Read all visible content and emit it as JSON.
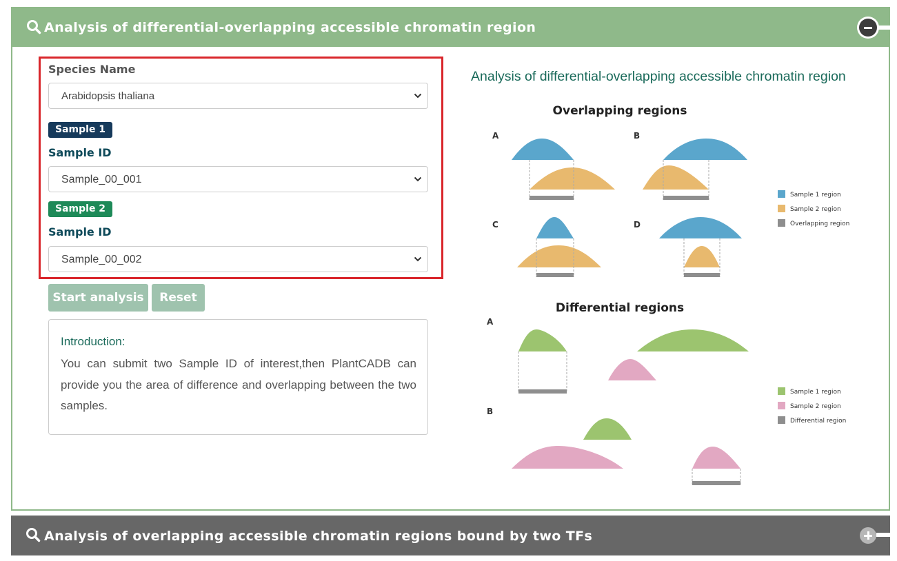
{
  "panel1": {
    "title": "Analysis of differential-overlapping accessible chromatin region"
  },
  "form": {
    "species_label": "Species Name",
    "species_value": "Arabidopsis thaliana",
    "sample1_badge": "Sample 1",
    "sample1_id_label": "Sample ID",
    "sample1_value": "Sample_00_001",
    "sample2_badge": "Sample 2",
    "sample2_id_label": "Sample ID",
    "sample2_value": "Sample_00_002",
    "start_label": "Start analysis",
    "reset_label": "Reset"
  },
  "intro": {
    "title": "Introduction:",
    "text": "You can submit two Sample ID of interest,then PlantCADB can provide you the area of difference and overlapping between the two samples."
  },
  "diagram": {
    "title": "Analysis of differential-overlapping accessible chromatin region",
    "overlap_heading": "Overlapping regions",
    "diff_heading": "Differential regions",
    "letters": {
      "a": "A",
      "b": "B",
      "c": "C",
      "d": "D"
    },
    "legend1": {
      "s1": "Sample 1 region",
      "s2": "Sample 2 region",
      "overlap": "Overlapping region"
    },
    "legend2": {
      "s1": "Sample 1 region",
      "s2": "Sample 2 region",
      "diff": "Differential region"
    },
    "colors": {
      "blue": "#5aa6cc",
      "orange": "#e8b96e",
      "green": "#9cc46f",
      "pink": "#e2a8c2",
      "gray": "#8e8e8e"
    }
  },
  "panel2": {
    "title": "Analysis of overlapping accessible chromatin regions bound by two TFs"
  },
  "colors": {
    "header_green": "#8fb98a",
    "header_gray": "#676767",
    "highlight_red": "#d9262b"
  }
}
